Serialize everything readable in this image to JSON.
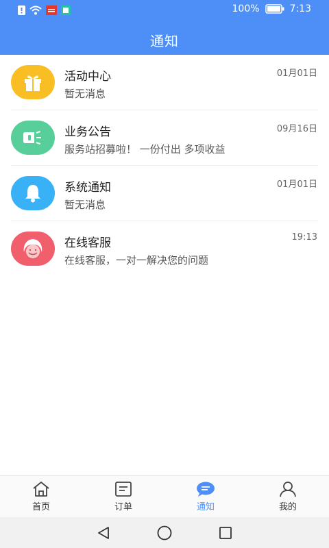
{
  "status_bar": {
    "battery": "100%",
    "time": "7:13",
    "icons": [
      "notification-alert-icon",
      "wifi-icon",
      "news-app-icon",
      "book-app-icon",
      "battery-icon"
    ]
  },
  "header": {
    "title": "通知"
  },
  "messages": [
    {
      "name": "活动中心",
      "desc": "暂无消息",
      "time": "01月01日",
      "icon": "gift-icon",
      "color": "#f8be23"
    },
    {
      "name": "业务公告",
      "desc": "服务站招募啦！ 一份付出 多项收益",
      "time": "09月16日",
      "icon": "megaphone-icon",
      "color": "#58cf9b"
    },
    {
      "name": "系统通知",
      "desc": "暂无消息",
      "time": "01月01日",
      "icon": "bell-icon",
      "color": "#38b1f6"
    },
    {
      "name": "在线客服",
      "desc": "在线客服，一对一解决您的问题",
      "time": "19:13",
      "icon": "customer-service-icon",
      "color": "#f15e6c"
    }
  ],
  "tabs": [
    {
      "label": "首页",
      "icon": "home-icon"
    },
    {
      "label": "订单",
      "icon": "order-icon"
    },
    {
      "label": "通知",
      "icon": "chat-icon",
      "active": true
    },
    {
      "label": "我的",
      "icon": "user-icon"
    }
  ],
  "accent_color": "#4e8ff7",
  "system_nav": [
    "back-icon",
    "home-circle-icon",
    "recents-icon"
  ]
}
